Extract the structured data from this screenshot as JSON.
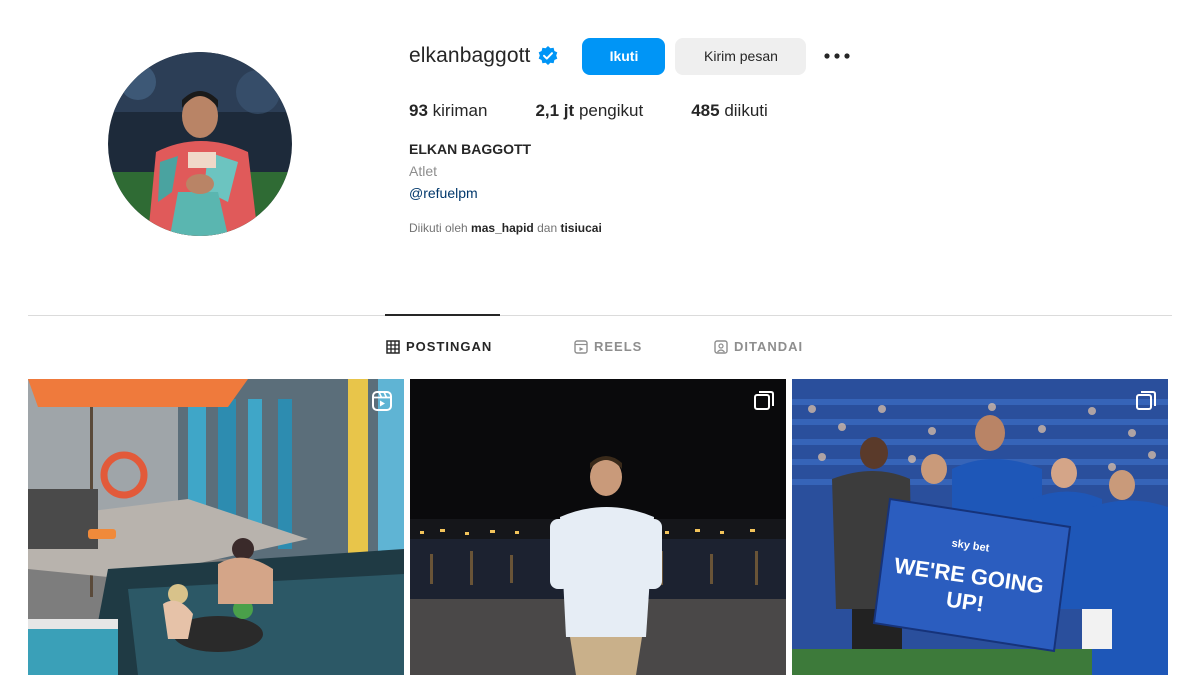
{
  "profile": {
    "username": "elkanbaggott",
    "follow_label": "Ikuti",
    "message_label": "Kirim pesan",
    "stats": {
      "posts_value": "93",
      "posts_label": "kiriman",
      "followers_value": "2,1 jt",
      "followers_label": "pengikut",
      "following_value": "485",
      "following_label": "diikuti"
    },
    "full_name": "ELKAN BAGGOTT",
    "category": "Atlet",
    "link": "@refuelpm",
    "followed_by": {
      "prefix": "Diikuti oleh",
      "user1": "mas_hapid",
      "joiner": "dan",
      "user2": "tisiucai"
    }
  },
  "tabs": [
    {
      "label": "POSTINGAN",
      "icon": "grid-icon"
    },
    {
      "label": "REELS",
      "icon": "reels-icon"
    },
    {
      "label": "DITANDAI",
      "icon": "tagged-icon"
    }
  ],
  "posts": [
    {
      "type_icon": "reels-icon",
      "banner": ""
    },
    {
      "type_icon": "carousel-icon",
      "banner": ""
    },
    {
      "type_icon": "carousel-icon",
      "banner_line1": "WE'RE GOING",
      "banner_line2": "UP!",
      "banner_brand": "sky bet"
    }
  ],
  "colors": {
    "accent": "#0095f6",
    "verified": "#0095f6",
    "text": "#262626",
    "muted": "#8e8e8e",
    "link": "#00376b"
  }
}
